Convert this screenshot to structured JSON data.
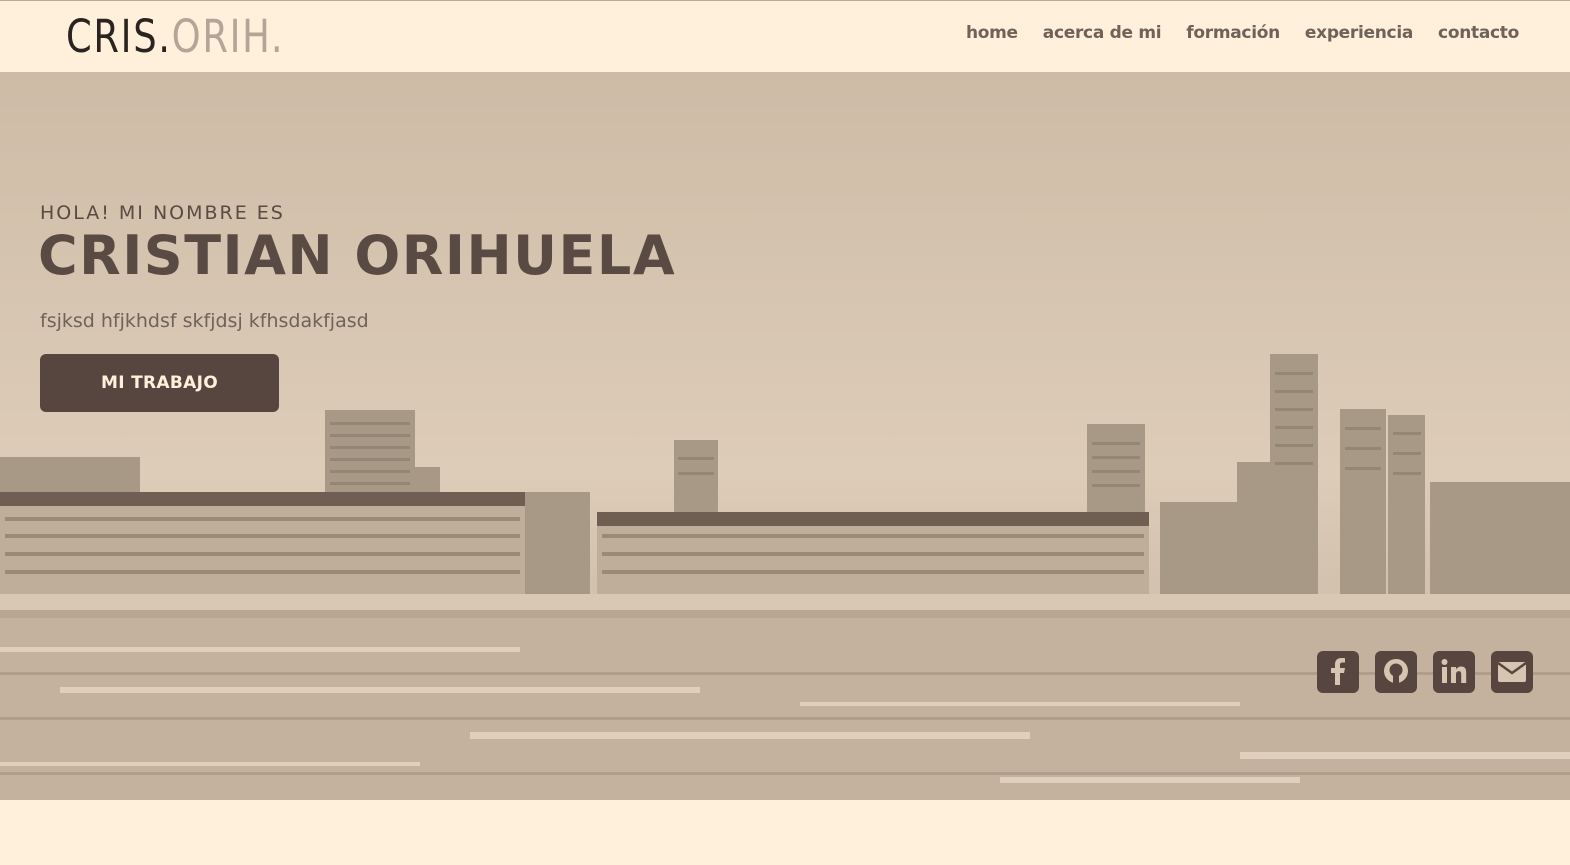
{
  "header": {
    "logo_primary": "CRIS.",
    "logo_secondary": "ORIH.",
    "nav": [
      {
        "label": "home"
      },
      {
        "label": "acerca de mi"
      },
      {
        "label": "formación"
      },
      {
        "label": "experiencia"
      },
      {
        "label": "contacto"
      }
    ]
  },
  "hero": {
    "greeting": "HOLA! MI NOMBRE ES",
    "name": "CRISTIAN ORIHUELA",
    "subtitle": "fsjksd hfjkhdsf skfjdsj kfhsdakfjasd",
    "button_label": "MI TRABAJO",
    "social_icons": [
      "facebook-icon",
      "github-icon",
      "linkedin-icon",
      "envelope-icon"
    ]
  },
  "colors": {
    "background": "#fef0da",
    "accent": "#574540",
    "text_dark": "#5a4a44",
    "nav_text": "#6e625a"
  }
}
